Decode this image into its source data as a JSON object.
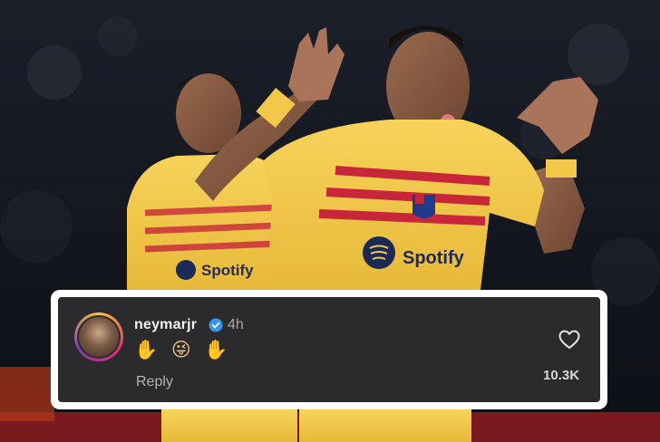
{
  "comment": {
    "username": "neymarjr",
    "time": "4h",
    "emojis": "✋ 😜 ✋",
    "reply_label": "Reply",
    "likes": "10.3K"
  },
  "photo": {
    "sponsor_left": "Spotify",
    "sponsor_right": "Spotify"
  },
  "colors": {
    "card_bg": "#2b2b2d",
    "frame": "#ffffff",
    "kit_yellow": "#f2c84b",
    "kit_red": "#c8273a",
    "verified_blue": "#3797f0"
  }
}
